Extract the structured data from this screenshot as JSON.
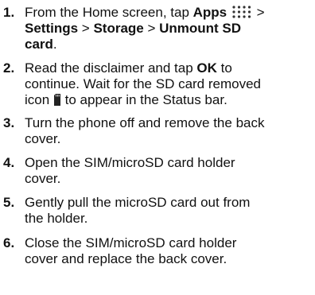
{
  "steps": [
    {
      "number": "1.",
      "line1_pre": "From the Home screen, tap ",
      "line1_apps": "Apps",
      "line1_post": " >",
      "line2_settings": "Settings",
      "line2_sep1": " > ",
      "line2_storage": "Storage",
      "line2_sep2": " > ",
      "line2_unmount": "Unmount SD",
      "line3_card": "card",
      "line3_period": "."
    },
    {
      "number": "2.",
      "line1_pre": "Read the disclaimer and tap ",
      "line1_ok": "OK",
      "line1_post": " to",
      "line2": "continue. Wait for the SD card removed",
      "line3_pre": "icon ",
      "line3_post": " to appear in the Status bar."
    },
    {
      "number": "3.",
      "line1": "Turn the phone off and remove the back",
      "line2": "cover."
    },
    {
      "number": "4.",
      "line1": "Open the SIM/microSD card holder",
      "line2": "cover."
    },
    {
      "number": "5.",
      "line1": "Gently pull the microSD card out from",
      "line2": "the holder."
    },
    {
      "number": "6.",
      "line1": "Close the SIM/microSD card holder",
      "line2": "cover and replace the back cover."
    }
  ],
  "icons": {
    "apps": "apps-grid-icon",
    "sd_removed": "sd-card-removed-icon"
  },
  "colors": {
    "text": "#111111",
    "icon": "#333333"
  }
}
